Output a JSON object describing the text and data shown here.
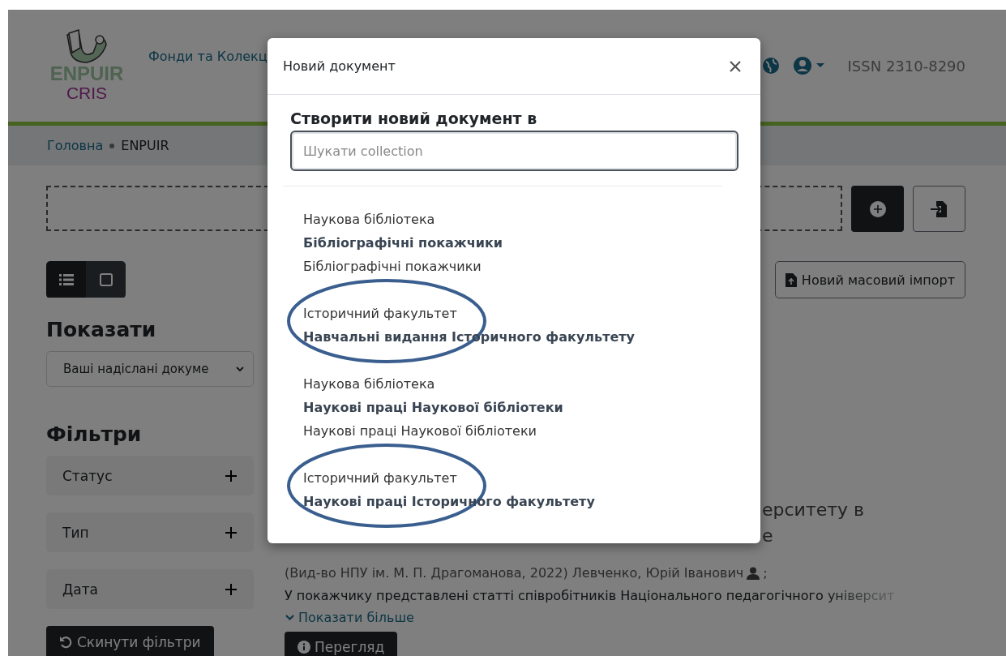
{
  "header": {
    "logo_top": "ENPUIR",
    "logo_bottom": "CRIS",
    "nav_link": "Фонди та Колекц",
    "issn": "ISSN 2310-8290"
  },
  "breadcrumb": [
    {
      "label": "Головна"
    },
    {
      "label": "ENPUIR"
    }
  ],
  "view_toggle": [
    {
      "kind": "list",
      "selected": true
    },
    {
      "kind": "grid",
      "selected": false
    }
  ],
  "mass_import_button": "Новий масовий імпорт",
  "show": {
    "heading": "Показати",
    "select_value": "Ваші надіслані докуме"
  },
  "filters": {
    "heading": "Фільтри",
    "items": [
      {
        "label": "Статус",
        "expanded": false
      },
      {
        "label": "Тип",
        "expanded": false
      },
      {
        "label": "Дата",
        "expanded": false
      }
    ],
    "reset_button": "Скинути фільтри"
  },
  "result": {
    "title_lines": [
      "ерситету в",
      "е"
    ],
    "meta": "(Вид-во НПУ ім. М. П. Драгоманова, 2022) Левченко, Юрій Іванович",
    "meta_end": ";",
    "abstract": "У покажчику представлені статті співробітників Національного педагогічного університ",
    "show_more": "Показати більше",
    "view_button": "Перегляд"
  },
  "modal": {
    "title": "Новий документ",
    "heading": "Створити новий документ в",
    "search": {
      "placeholder": "Шукати collection"
    },
    "items": [
      {
        "parent": "Наукова бібліотека",
        "name": "Бібліографічні покажчики",
        "description": "Бібліографічні покажчики",
        "circled": false
      },
      {
        "parent": "Історичний факультет",
        "name": "Навчальні видання Історичного факультету",
        "circled": true
      },
      {
        "parent": "Наукова бібліотека",
        "name": "Наукові праці Наукової бібліотеки",
        "description": "Наукові праці Наукової бібліотеки",
        "circled": false
      },
      {
        "parent": "Історичний факультет",
        "name": "Наукові праці Історичного факультету",
        "circled": true
      }
    ]
  }
}
